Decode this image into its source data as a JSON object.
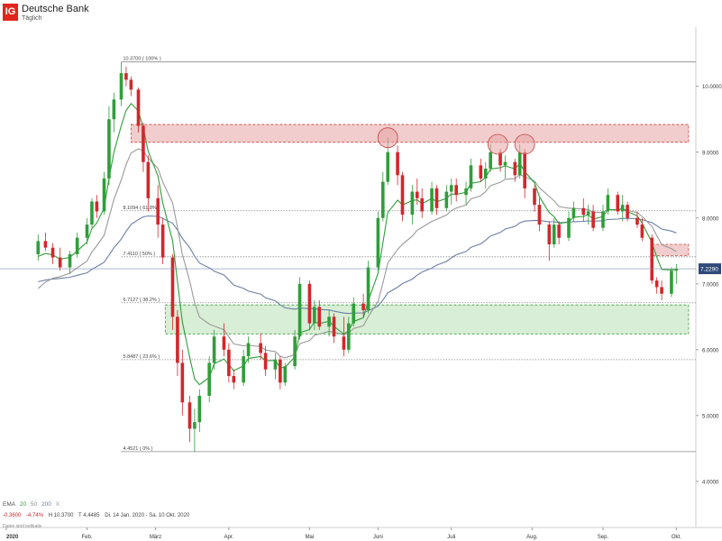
{
  "header": {
    "logo": "IG",
    "title": "Deutsche Bank",
    "subtitle": "Täglich"
  },
  "ema_legend": {
    "label": "EMA",
    "periods": [
      "20",
      "50",
      "200"
    ],
    "close": "X",
    "colors": {
      "ema20": "#2f9e3a",
      "ema50": "#8a8a8a",
      "ema200": "#6b7fa6"
    }
  },
  "quote_bar": {
    "change": "-0.3600",
    "change_pct": "-4.74%",
    "high": "H 10.3700",
    "low": "T 4.4485",
    "range": "Di. 14 Jan. 2020 - Sa. 10 Okt. 2020"
  },
  "footnote": "Daten sind indikativ",
  "chart_data": {
    "type": "candlestick",
    "title": "Deutsche Bank",
    "subtitle": "Täglich",
    "x_labels": [
      {
        "label": "2020",
        "date": "2020-01-01"
      },
      {
        "label": "Feb.",
        "date": "2020-02-03"
      },
      {
        "label": "März",
        "date": "2020-03-02"
      },
      {
        "label": "Apr.",
        "date": "2020-04-01"
      },
      {
        "label": "Mai",
        "date": "2020-05-04"
      },
      {
        "label": "Juni",
        "date": "2020-06-01"
      },
      {
        "label": "Juli",
        "date": "2020-07-01"
      },
      {
        "label": "Aug.",
        "date": "2020-08-03"
      },
      {
        "label": "Sep.",
        "date": "2020-09-01"
      },
      {
        "label": "Okt.",
        "date": "2020-10-01"
      }
    ],
    "y_ticks": [
      "4.0000",
      "5.0000",
      "6.0000",
      "7.0000",
      "8.0000",
      "9.0000",
      "10.0000"
    ],
    "ylim": [
      3.3,
      10.9
    ],
    "last_price": {
      "label": "7.2290",
      "value": 7.229,
      "color": "#2f4a7a"
    },
    "candle_colors": {
      "up": "#2f9e3a",
      "down": "#d3262b"
    },
    "fibonacci": [
      {
        "label": "10.3700 ( 100% )",
        "value": 10.37
      },
      {
        "label": "8.1094 ( 61.8% )",
        "value": 8.1094
      },
      {
        "label": "7.4110 ( 50% )",
        "value": 7.411
      },
      {
        "label": "6.7127 ( 38.2% )",
        "value": 6.7127
      },
      {
        "label": "5.8487 ( 23.6% )",
        "value": 5.8487
      },
      {
        "label": "4.4521 ( 0% )",
        "value": 4.4521
      }
    ],
    "resistance_zones": [
      {
        "from_date": "2020-02-21",
        "to_date": "2020-10-06",
        "low": 9.15,
        "high": 9.42,
        "color": "#e8a4a4"
      },
      {
        "from_date": "2020-09-21",
        "to_date": "2020-10-06",
        "low": 7.43,
        "high": 7.6,
        "color": "#e8a4a4"
      }
    ],
    "support_zones": [
      {
        "from_date": "2020-03-06",
        "to_date": "2020-10-06",
        "low": 6.24,
        "high": 6.68,
        "color": "#b9e0b4"
      }
    ],
    "circles": [
      {
        "date": "2020-06-05",
        "value": 9.22
      },
      {
        "date": "2020-07-20",
        "value": 9.12
      },
      {
        "date": "2020-07-31",
        "value": 9.12
      }
    ],
    "candles": [
      {
        "date": "2020-01-14",
        "open": 7.45,
        "high": 7.75,
        "low": 7.35,
        "close": 7.65
      },
      {
        "date": "2020-01-17",
        "open": 7.65,
        "high": 7.78,
        "low": 7.5,
        "close": 7.55
      },
      {
        "date": "2020-01-20",
        "open": 7.55,
        "high": 7.62,
        "low": 7.3,
        "close": 7.4
      },
      {
        "date": "2020-01-23",
        "open": 7.4,
        "high": 7.55,
        "low": 7.2,
        "close": 7.25
      },
      {
        "date": "2020-01-27",
        "open": 7.25,
        "high": 7.5,
        "low": 7.15,
        "close": 7.45
      },
      {
        "date": "2020-01-30",
        "open": 7.45,
        "high": 7.78,
        "low": 7.4,
        "close": 7.7
      },
      {
        "date": "2020-02-03",
        "open": 7.7,
        "high": 8.0,
        "low": 7.6,
        "close": 7.9
      },
      {
        "date": "2020-02-05",
        "open": 7.9,
        "high": 8.3,
        "low": 7.85,
        "close": 8.25
      },
      {
        "date": "2020-02-07",
        "open": 8.25,
        "high": 8.35,
        "low": 8.0,
        "close": 8.1
      },
      {
        "date": "2020-02-10",
        "open": 8.1,
        "high": 8.7,
        "low": 8.05,
        "close": 8.6
      },
      {
        "date": "2020-02-12",
        "open": 8.6,
        "high": 9.7,
        "low": 8.5,
        "close": 9.5
      },
      {
        "date": "2020-02-14",
        "open": 9.5,
        "high": 9.9,
        "low": 9.3,
        "close": 9.8
      },
      {
        "date": "2020-02-17",
        "open": 9.8,
        "high": 10.37,
        "low": 9.7,
        "close": 10.2
      },
      {
        "date": "2020-02-19",
        "open": 10.2,
        "high": 10.3,
        "low": 10.0,
        "close": 10.1
      },
      {
        "date": "2020-02-21",
        "open": 10.1,
        "high": 10.15,
        "low": 9.85,
        "close": 9.95
      },
      {
        "date": "2020-02-24",
        "open": 9.95,
        "high": 9.98,
        "low": 9.3,
        "close": 9.4
      },
      {
        "date": "2020-02-26",
        "open": 9.4,
        "high": 9.45,
        "low": 8.7,
        "close": 8.85
      },
      {
        "date": "2020-02-28",
        "open": 8.85,
        "high": 8.95,
        "low": 8.1,
        "close": 8.3
      },
      {
        "date": "2020-03-03",
        "open": 8.3,
        "high": 8.5,
        "low": 7.7,
        "close": 7.9
      },
      {
        "date": "2020-03-05",
        "open": 7.9,
        "high": 8.0,
        "low": 7.3,
        "close": 7.4
      },
      {
        "date": "2020-03-09",
        "open": 7.4,
        "high": 7.45,
        "low": 6.3,
        "close": 6.5
      },
      {
        "date": "2020-03-11",
        "open": 6.5,
        "high": 6.6,
        "low": 5.6,
        "close": 5.8
      },
      {
        "date": "2020-03-13",
        "open": 5.8,
        "high": 6.0,
        "low": 5.0,
        "close": 5.2
      },
      {
        "date": "2020-03-16",
        "open": 5.2,
        "high": 5.3,
        "low": 4.6,
        "close": 4.8
      },
      {
        "date": "2020-03-18",
        "open": 4.8,
        "high": 5.1,
        "low": 4.45,
        "close": 4.9
      },
      {
        "date": "2020-03-20",
        "open": 4.9,
        "high": 5.4,
        "low": 4.75,
        "close": 5.3
      },
      {
        "date": "2020-03-24",
        "open": 5.3,
        "high": 5.9,
        "low": 5.2,
        "close": 5.8
      },
      {
        "date": "2020-03-26",
        "open": 5.8,
        "high": 6.3,
        "low": 5.7,
        "close": 6.2
      },
      {
        "date": "2020-03-30",
        "open": 6.2,
        "high": 6.4,
        "low": 5.9,
        "close": 6.0
      },
      {
        "date": "2020-04-01",
        "open": 6.0,
        "high": 6.1,
        "low": 5.5,
        "close": 5.6
      },
      {
        "date": "2020-04-03",
        "open": 5.6,
        "high": 5.7,
        "low": 5.4,
        "close": 5.5
      },
      {
        "date": "2020-04-07",
        "open": 5.5,
        "high": 6.0,
        "low": 5.45,
        "close": 5.9
      },
      {
        "date": "2020-04-09",
        "open": 5.9,
        "high": 6.2,
        "low": 5.8,
        "close": 6.1
      },
      {
        "date": "2020-04-14",
        "open": 6.1,
        "high": 6.25,
        "low": 5.85,
        "close": 5.95
      },
      {
        "date": "2020-04-16",
        "open": 5.95,
        "high": 6.05,
        "low": 5.6,
        "close": 5.7
      },
      {
        "date": "2020-04-20",
        "open": 5.7,
        "high": 5.95,
        "low": 5.55,
        "close": 5.85
      },
      {
        "date": "2020-04-22",
        "open": 5.85,
        "high": 5.9,
        "low": 5.4,
        "close": 5.5
      },
      {
        "date": "2020-04-24",
        "open": 5.5,
        "high": 5.8,
        "low": 5.45,
        "close": 5.75
      },
      {
        "date": "2020-04-28",
        "open": 5.75,
        "high": 6.3,
        "low": 5.7,
        "close": 6.2
      },
      {
        "date": "2020-04-30",
        "open": 6.2,
        "high": 7.1,
        "low": 6.15,
        "close": 7.0
      },
      {
        "date": "2020-05-04",
        "open": 7.0,
        "high": 7.05,
        "low": 6.3,
        "close": 6.4
      },
      {
        "date": "2020-05-06",
        "open": 6.4,
        "high": 6.75,
        "low": 6.3,
        "close": 6.65
      },
      {
        "date": "2020-05-08",
        "open": 6.65,
        "high": 6.75,
        "low": 6.3,
        "close": 6.35
      },
      {
        "date": "2020-05-12",
        "open": 6.35,
        "high": 6.6,
        "low": 6.2,
        "close": 6.5
      },
      {
        "date": "2020-05-14",
        "open": 6.5,
        "high": 6.55,
        "low": 6.1,
        "close": 6.2
      },
      {
        "date": "2020-05-18",
        "open": 6.2,
        "high": 6.5,
        "low": 5.9,
        "close": 6.0
      },
      {
        "date": "2020-05-20",
        "open": 6.0,
        "high": 6.5,
        "low": 5.95,
        "close": 6.4
      },
      {
        "date": "2020-05-22",
        "open": 6.4,
        "high": 6.8,
        "low": 6.35,
        "close": 6.7
      },
      {
        "date": "2020-05-26",
        "open": 6.7,
        "high": 6.85,
        "low": 6.5,
        "close": 6.6
      },
      {
        "date": "2020-05-28",
        "open": 6.6,
        "high": 7.35,
        "low": 6.55,
        "close": 7.25
      },
      {
        "date": "2020-06-01",
        "open": 7.25,
        "high": 8.1,
        "low": 7.2,
        "close": 8.0
      },
      {
        "date": "2020-06-03",
        "open": 8.0,
        "high": 8.7,
        "low": 7.95,
        "close": 8.55
      },
      {
        "date": "2020-06-05",
        "open": 8.55,
        "high": 9.22,
        "low": 8.5,
        "close": 9.0
      },
      {
        "date": "2020-06-09",
        "open": 9.0,
        "high": 9.1,
        "low": 8.5,
        "close": 8.65
      },
      {
        "date": "2020-06-11",
        "open": 8.65,
        "high": 8.7,
        "low": 7.95,
        "close": 8.05
      },
      {
        "date": "2020-06-15",
        "open": 8.05,
        "high": 8.5,
        "low": 7.9,
        "close": 8.4
      },
      {
        "date": "2020-06-17",
        "open": 8.4,
        "high": 8.6,
        "low": 8.2,
        "close": 8.3
      },
      {
        "date": "2020-06-19",
        "open": 8.3,
        "high": 8.45,
        "low": 8.0,
        "close": 8.1
      },
      {
        "date": "2020-06-23",
        "open": 8.1,
        "high": 8.55,
        "low": 8.05,
        "close": 8.45
      },
      {
        "date": "2020-06-25",
        "open": 8.45,
        "high": 8.5,
        "low": 8.05,
        "close": 8.15
      },
      {
        "date": "2020-06-29",
        "open": 8.15,
        "high": 8.5,
        "low": 8.1,
        "close": 8.4
      },
      {
        "date": "2020-07-01",
        "open": 8.4,
        "high": 8.6,
        "low": 8.2,
        "close": 8.5
      },
      {
        "date": "2020-07-03",
        "open": 8.5,
        "high": 8.6,
        "low": 8.25,
        "close": 8.35
      },
      {
        "date": "2020-07-07",
        "open": 8.35,
        "high": 8.55,
        "low": 8.2,
        "close": 8.45
      },
      {
        "date": "2020-07-09",
        "open": 8.45,
        "high": 8.9,
        "low": 8.4,
        "close": 8.8
      },
      {
        "date": "2020-07-13",
        "open": 8.8,
        "high": 8.9,
        "low": 8.55,
        "close": 8.6
      },
      {
        "date": "2020-07-15",
        "open": 8.6,
        "high": 8.85,
        "low": 8.45,
        "close": 8.75
      },
      {
        "date": "2020-07-17",
        "open": 8.75,
        "high": 9.12,
        "low": 8.7,
        "close": 9.0
      },
      {
        "date": "2020-07-21",
        "open": 9.0,
        "high": 9.05,
        "low": 8.7,
        "close": 8.8
      },
      {
        "date": "2020-07-23",
        "open": 8.8,
        "high": 8.95,
        "low": 8.6,
        "close": 8.85
      },
      {
        "date": "2020-07-27",
        "open": 8.85,
        "high": 8.9,
        "low": 8.55,
        "close": 8.65
      },
      {
        "date": "2020-07-29",
        "open": 8.65,
        "high": 9.12,
        "low": 8.6,
        "close": 9.0
      },
      {
        "date": "2020-07-31",
        "open": 9.0,
        "high": 9.05,
        "low": 8.3,
        "close": 8.45
      },
      {
        "date": "2020-08-04",
        "open": 8.45,
        "high": 8.5,
        "low": 8.1,
        "close": 8.2
      },
      {
        "date": "2020-08-06",
        "open": 8.2,
        "high": 8.3,
        "low": 7.8,
        "close": 7.9
      },
      {
        "date": "2020-08-10",
        "open": 7.9,
        "high": 7.95,
        "low": 7.35,
        "close": 7.6
      },
      {
        "date": "2020-08-12",
        "open": 7.6,
        "high": 8.0,
        "low": 7.55,
        "close": 7.9
      },
      {
        "date": "2020-08-14",
        "open": 7.9,
        "high": 7.95,
        "low": 7.6,
        "close": 7.7
      },
      {
        "date": "2020-08-18",
        "open": 7.7,
        "high": 8.1,
        "low": 7.65,
        "close": 8.0
      },
      {
        "date": "2020-08-20",
        "open": 8.0,
        "high": 8.25,
        "low": 7.95,
        "close": 8.15
      },
      {
        "date": "2020-08-24",
        "open": 8.15,
        "high": 8.3,
        "low": 7.95,
        "close": 8.05
      },
      {
        "date": "2020-08-26",
        "open": 8.05,
        "high": 8.2,
        "low": 7.9,
        "close": 8.1
      },
      {
        "date": "2020-08-28",
        "open": 8.1,
        "high": 8.2,
        "low": 7.8,
        "close": 7.85
      },
      {
        "date": "2020-09-01",
        "open": 7.85,
        "high": 8.2,
        "low": 7.8,
        "close": 8.1
      },
      {
        "date": "2020-09-03",
        "open": 8.1,
        "high": 8.45,
        "low": 8.05,
        "close": 8.35
      },
      {
        "date": "2020-09-07",
        "open": 8.35,
        "high": 8.4,
        "low": 8.05,
        "close": 8.1
      },
      {
        "date": "2020-09-09",
        "open": 8.1,
        "high": 8.35,
        "low": 7.95,
        "close": 8.2
      },
      {
        "date": "2020-09-11",
        "open": 8.2,
        "high": 8.25,
        "low": 7.95,
        "close": 8.0
      },
      {
        "date": "2020-09-15",
        "open": 8.0,
        "high": 8.1,
        "low": 7.85,
        "close": 7.9
      },
      {
        "date": "2020-09-17",
        "open": 7.9,
        "high": 8.0,
        "low": 7.65,
        "close": 7.7
      },
      {
        "date": "2020-09-21",
        "open": 7.7,
        "high": 7.75,
        "low": 7.0,
        "close": 7.05
      },
      {
        "date": "2020-09-23",
        "open": 7.05,
        "high": 7.1,
        "low": 6.85,
        "close": 6.95
      },
      {
        "date": "2020-09-25",
        "open": 6.95,
        "high": 7.05,
        "low": 6.75,
        "close": 6.85
      },
      {
        "date": "2020-09-29",
        "open": 6.85,
        "high": 7.25,
        "low": 6.8,
        "close": 7.2
      },
      {
        "date": "2020-10-01",
        "open": 7.2,
        "high": 7.3,
        "low": 7.0,
        "close": 7.229
      }
    ]
  }
}
